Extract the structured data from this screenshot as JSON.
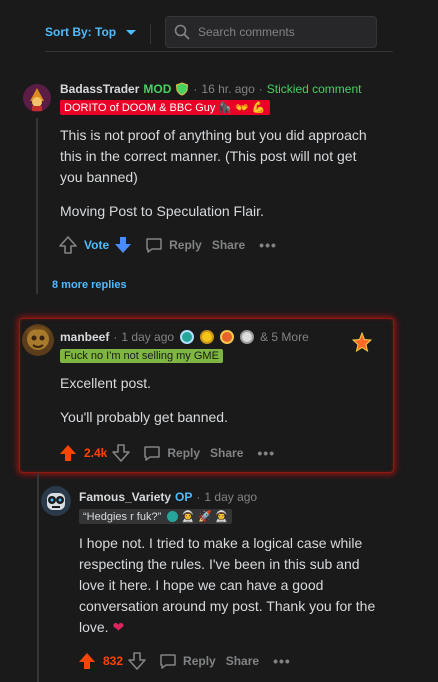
{
  "sort": {
    "label": "Sort By: Top"
  },
  "search": {
    "placeholder": "Search comments"
  },
  "comments": [
    {
      "author": "BadassTrader",
      "mod_label": "MOD",
      "time": "16 hr. ago",
      "sticky": "Stickied comment",
      "flair": "DORITO of DOOM & BBC Guy",
      "paragraphs": [
        "This is not proof of anything but you did approach this in the correct manner. (This post will not get you banned)",
        "Moving Post to Speculation Flair."
      ],
      "vote_label": "Vote",
      "reply": "Reply",
      "share": "Share",
      "more_replies": "8 more replies"
    },
    {
      "author": "manbeef",
      "time": "1 day ago",
      "awards_more": "& 5 More",
      "flair": "Fuck no I'm not selling my GME",
      "paragraphs": [
        "Excellent post.",
        "You'll probably get banned."
      ],
      "score": "2.4k",
      "reply": "Reply",
      "share": "Share"
    },
    {
      "author": "Famous_Variety",
      "op_label": "OP",
      "time": "1 day ago",
      "flair": "“Hedgies r fuk?”",
      "paragraphs": [
        "I hope not. I tried to make a logical case while respecting the rules. I've been in this sub and love it here. I hope we can have a good conversation around my post. Thank you for the love."
      ],
      "score": "832",
      "reply": "Reply",
      "share": "Share"
    }
  ],
  "colors": {
    "upvote": "#ff4500",
    "vote_blue": "#4fbcff",
    "mod_green": "#46d160",
    "flair_red": "#ea0027",
    "flair_green": "#7eb543"
  }
}
